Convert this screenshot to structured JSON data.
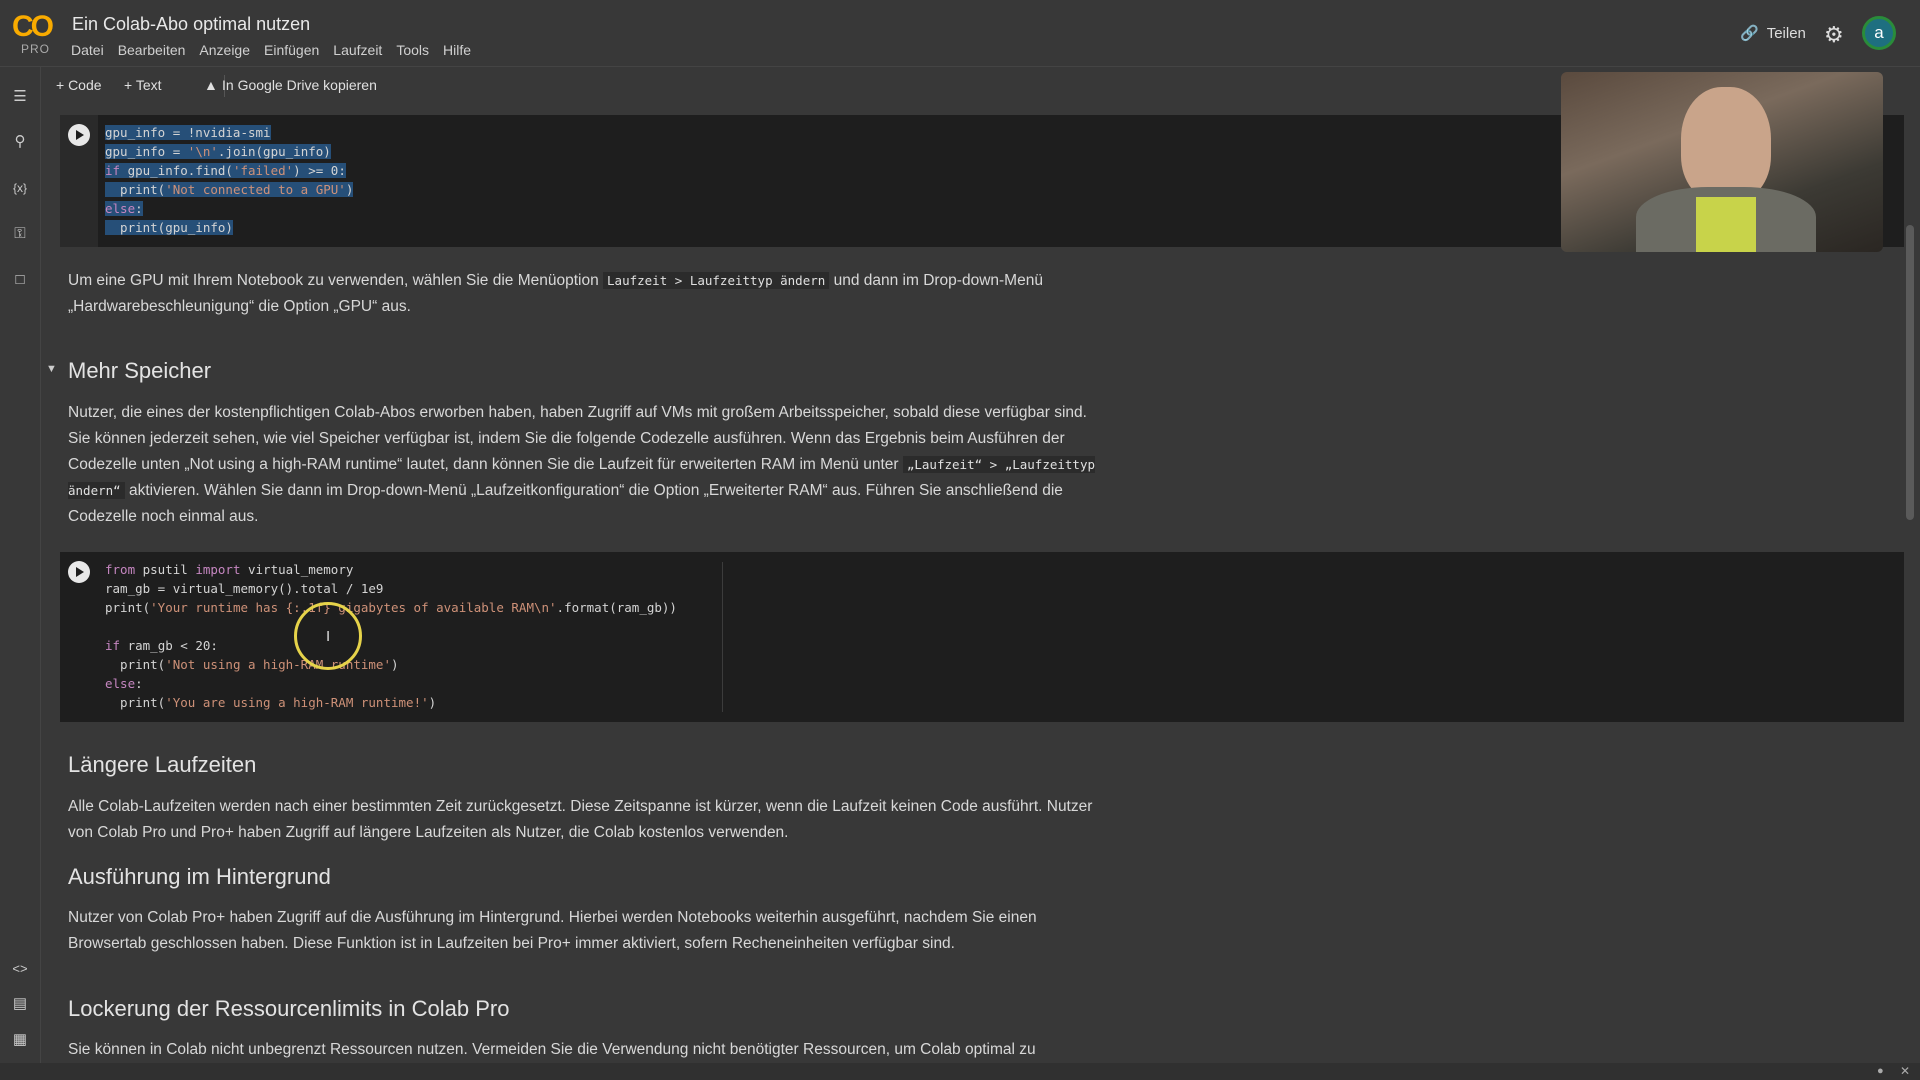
{
  "app": {
    "logo_text": "CO",
    "logo_badge": "PRO",
    "title": "Ein Colab-Abo optimal nutzen"
  },
  "menu": [
    "Datei",
    "Bearbeiten",
    "Anzeige",
    "Einfügen",
    "Laufzeit",
    "Tools",
    "Hilfe"
  ],
  "header": {
    "share_label": "Teilen",
    "avatar_letter": "a"
  },
  "toolbar": {
    "add_code": "+ Code",
    "add_text": "+ Text",
    "copy_drive": "In Google Drive kopieren"
  },
  "cells": {
    "text1": {
      "before": "Um eine GPU mit Ihrem Notebook zu verwenden, wählen Sie die Menüoption ",
      "code": "Laufzeit > Laufzeittyp ändern",
      "after": " und dann im Drop-down-Menü „Hardwarebeschleunigung“ die Option „GPU“ aus."
    },
    "section_more_memory": "Mehr Speicher",
    "text2": {
      "part1": "Nutzer, die eines der kostenpflichtigen Colab-Abos erworben haben, haben Zugriff auf VMs mit großem Arbeitsspeicher, sobald diese verfügbar sind. Sie können jederzeit sehen, wie viel Speicher verfügbar ist, indem Sie die folgende Codezelle ausführen. Wenn das Ergebnis beim Ausführen der Codezelle unten „Not using a high-RAM runtime“ lautet, dann können Sie die Laufzeit für erweiterten RAM im Menü unter ",
      "code": "„Laufzeit“ > „Laufzeittyp ändern“",
      "part2": " aktivieren. Wählen Sie dann im Drop-down-Menü „Laufzeitkonfiguration“ die Option „Erweiterter RAM“ aus. Führen Sie anschließend die Codezelle noch einmal aus."
    },
    "section_longer": "Längere Laufzeiten",
    "text3": "Alle Colab-Laufzeiten werden nach einer bestimmten Zeit zurückgesetzt. Diese Zeitspanne ist kürzer, wenn die Laufzeit keinen Code ausführt. Nutzer von Colab Pro und Pro+ haben Zugriff auf längere Laufzeiten als Nutzer, die Colab kostenlos verwenden.",
    "section_background": "Ausführung im Hintergrund",
    "text4": "Nutzer von Colab Pro+ haben Zugriff auf die Ausführung im Hintergrund. Hierbei werden Notebooks weiterhin ausgeführt, nachdem Sie einen Browsertab geschlossen haben. Diese Funktion ist in Laufzeiten bei Pro+ immer aktiviert, sofern Recheneinheiten verfügbar sind.",
    "section_limits": "Lockerung der Ressourcenlimits in Colab Pro",
    "text5": "Sie können in Colab nicht unbegrenzt Ressourcen nutzen. Vermeiden Sie die Verwendung nicht benötigter Ressourcen, um Colab optimal zu"
  },
  "code1": [
    [
      "gpu_info = !nvidia-smi"
    ],
    [
      "gpu_info = ",
      "'\\n'",
      ".join(gpu_info)"
    ],
    [
      "if",
      " gpu_info.find(",
      "'failed'",
      ") >= 0:"
    ],
    [
      "  print(",
      "'Not connected to a GPU'",
      ")"
    ],
    [
      "else",
      ":"
    ],
    [
      "  print(gpu_info)"
    ]
  ],
  "code2": [
    [
      "from",
      " psutil ",
      "import",
      " virtual_memory"
    ],
    [
      "ram_gb = virtual_memory().total / 1e9"
    ],
    [
      "print(",
      "'Your runtime has {:.1f} gigabytes of available RAM\\n'",
      ".format(ram_gb))"
    ],
    [
      ""
    ],
    [
      "if",
      " ram_gb < 20:"
    ],
    [
      "  print(",
      "'Not using a high-RAM runtime'",
      ")"
    ],
    [
      "else",
      ":"
    ],
    [
      "  print(",
      "'You are using a high-RAM runtime!'",
      ")"
    ]
  ],
  "colors": {
    "accent": "#f9ab00",
    "keyword": "#c586c0",
    "string": "#ce9178",
    "selection": "#264f78"
  }
}
